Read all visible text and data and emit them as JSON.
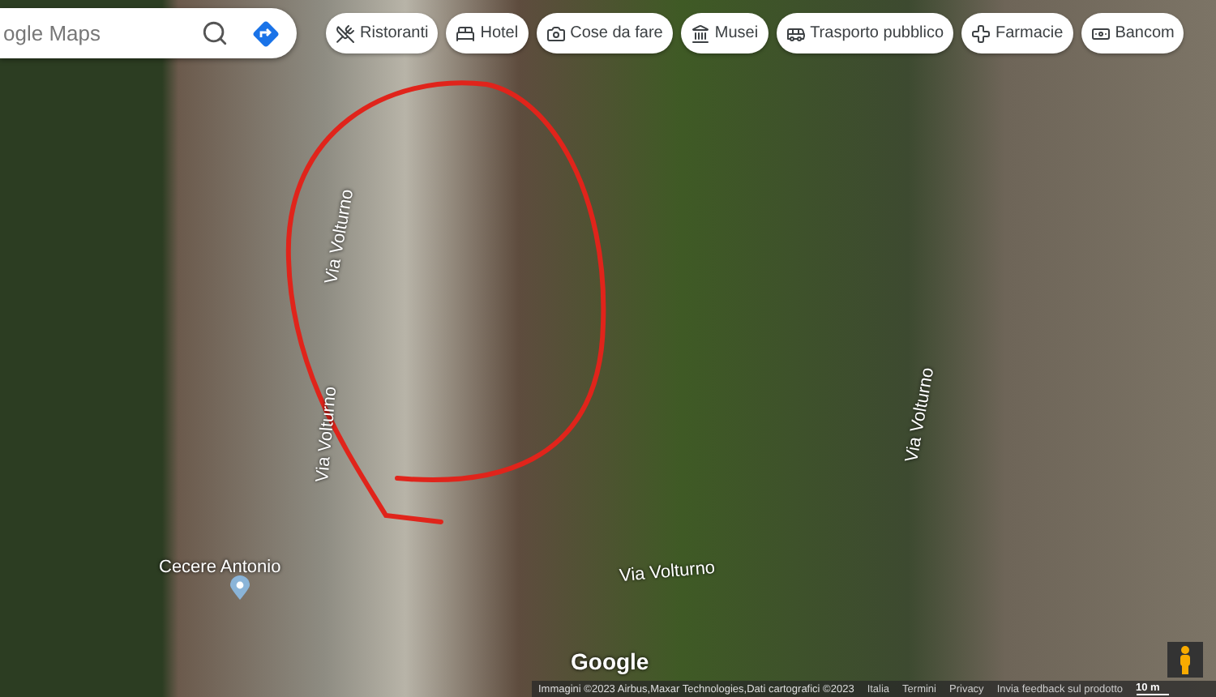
{
  "search": {
    "placeholder": "ogle Maps"
  },
  "chips": [
    {
      "label": "Ristoranti"
    },
    {
      "label": "Hotel"
    },
    {
      "label": "Cose da fare"
    },
    {
      "label": "Musei"
    },
    {
      "label": "Trasporto pubblico"
    },
    {
      "label": "Farmacie"
    },
    {
      "label": "Bancom"
    }
  ],
  "map_labels": [
    {
      "kind": "road",
      "label": "Via Volturno"
    },
    {
      "kind": "road",
      "label": "Via Volturno"
    },
    {
      "kind": "road",
      "label": "Via Volturno"
    },
    {
      "kind": "road",
      "label": "Via Volturno"
    },
    {
      "kind": "place",
      "label": "Cecere Antonio"
    }
  ],
  "logo": "Google",
  "footer": {
    "attribution": "Immagini ©2023 Airbus,Maxar Technologies,Dati cartografici ©2023",
    "links": [
      "Italia",
      "Termini",
      "Privacy",
      "Invia feedback sul prodotto"
    ],
    "scale": "10 m"
  }
}
